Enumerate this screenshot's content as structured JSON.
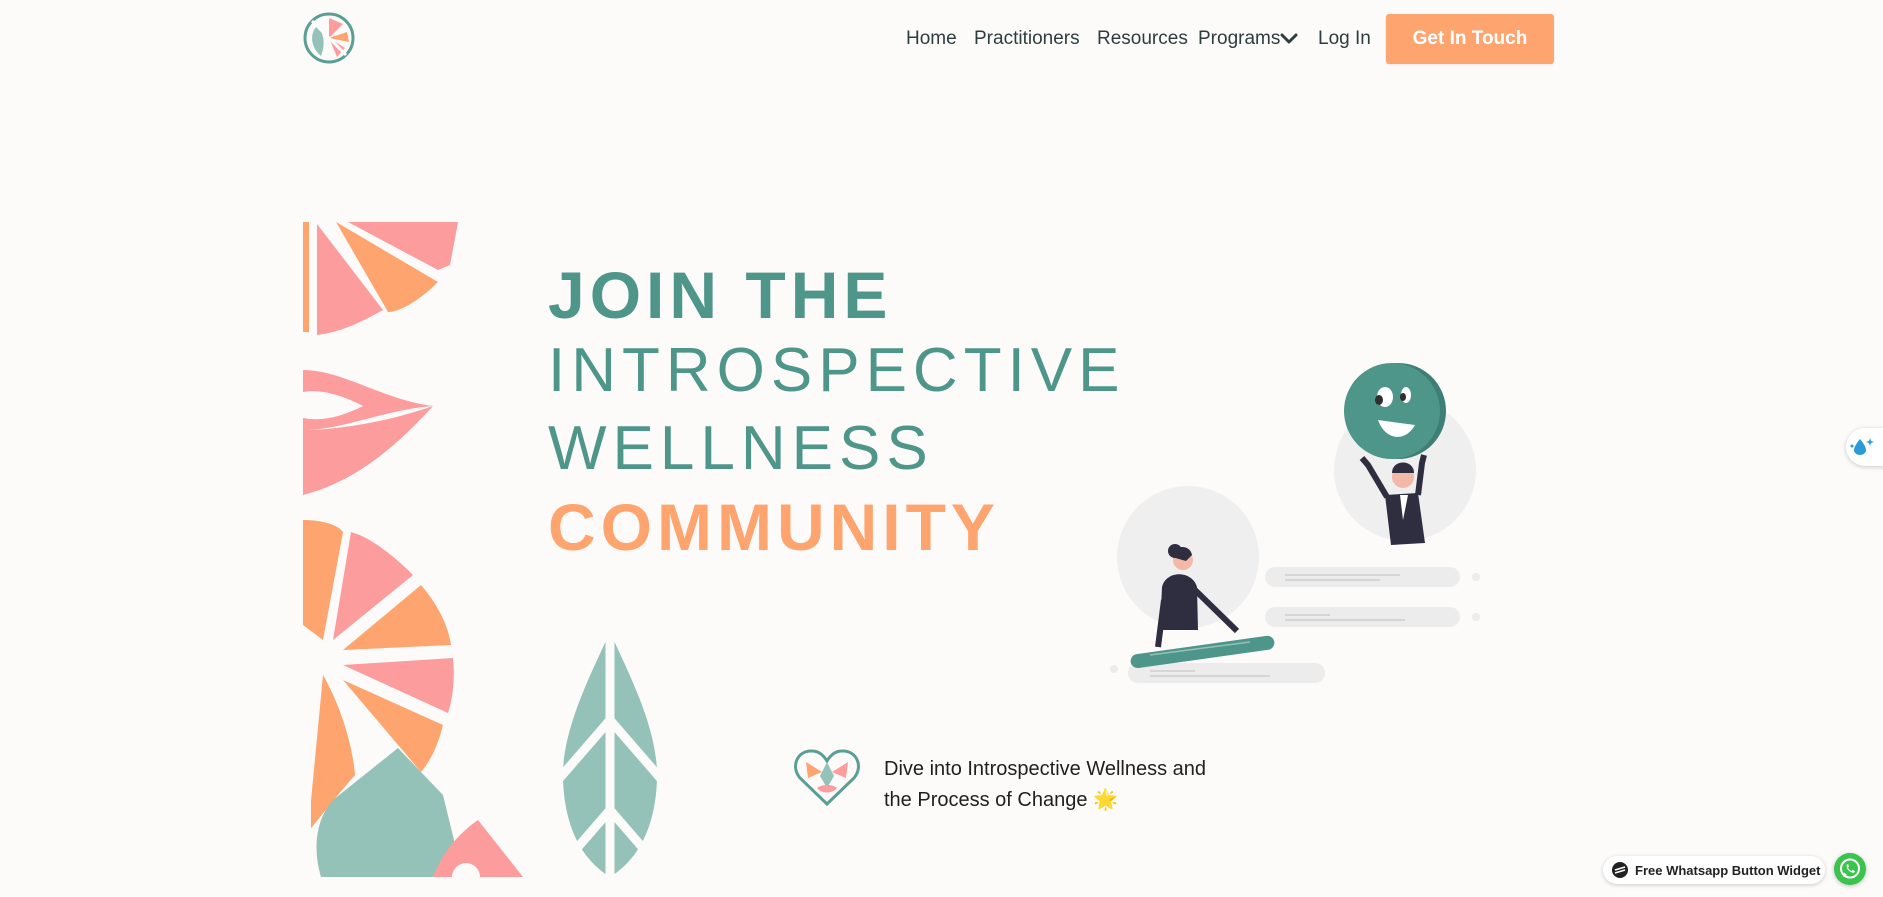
{
  "header": {
    "logo_icon": "leaf-citrus-logo-icon",
    "nav": {
      "home": "Home",
      "practitioners": "Practitioners",
      "resources": "Resources",
      "programs": "Programs",
      "programs_icon": "chevron-down-icon",
      "login": "Log In"
    },
    "cta_label": "Get In Touch"
  },
  "hero": {
    "headline": {
      "line1": "JOIN THE",
      "line2": "INTROSPECTIVE",
      "line3": "WELLNESS",
      "line4": "COMMUNITY"
    },
    "decoration_icon": "citrus-leaf-pattern",
    "illustration_icon": "people-with-smiley-illustration",
    "tagline": {
      "icon": "heart-logo-icon",
      "line1": "Dive into Introspective Wellness and",
      "line2": "the Process of Change 🌟"
    }
  },
  "widgets": {
    "side_icon": "water-drop-icon",
    "whatsapp_label": "Free Whatsapp Button Widget",
    "whatsapp_icon": "whatsapp-icon"
  },
  "colors": {
    "teal": "#4e958a",
    "orange": "#fda46f",
    "pink": "#fc9c9c",
    "light_teal": "#94c2b9",
    "background": "#fdfbf9"
  }
}
